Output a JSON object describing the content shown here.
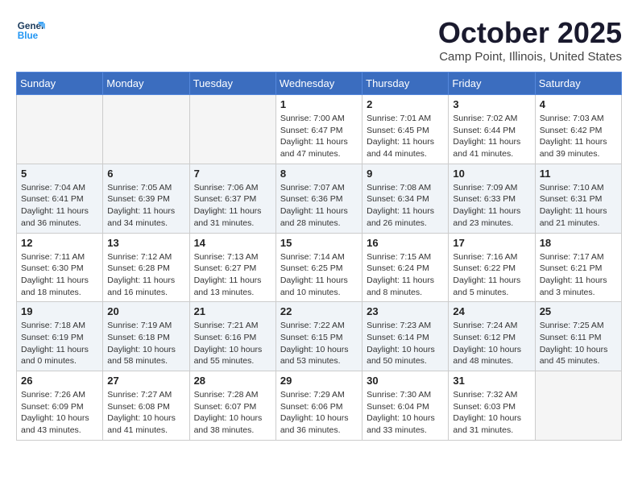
{
  "header": {
    "logo_line1": "General",
    "logo_line2": "Blue",
    "month": "October 2025",
    "location": "Camp Point, Illinois, United States"
  },
  "weekdays": [
    "Sunday",
    "Monday",
    "Tuesday",
    "Wednesday",
    "Thursday",
    "Friday",
    "Saturday"
  ],
  "weeks": [
    [
      {
        "day": "",
        "info": ""
      },
      {
        "day": "",
        "info": ""
      },
      {
        "day": "",
        "info": ""
      },
      {
        "day": "1",
        "info": "Sunrise: 7:00 AM\nSunset: 6:47 PM\nDaylight: 11 hours\nand 47 minutes."
      },
      {
        "day": "2",
        "info": "Sunrise: 7:01 AM\nSunset: 6:45 PM\nDaylight: 11 hours\nand 44 minutes."
      },
      {
        "day": "3",
        "info": "Sunrise: 7:02 AM\nSunset: 6:44 PM\nDaylight: 11 hours\nand 41 minutes."
      },
      {
        "day": "4",
        "info": "Sunrise: 7:03 AM\nSunset: 6:42 PM\nDaylight: 11 hours\nand 39 minutes."
      }
    ],
    [
      {
        "day": "5",
        "info": "Sunrise: 7:04 AM\nSunset: 6:41 PM\nDaylight: 11 hours\nand 36 minutes."
      },
      {
        "day": "6",
        "info": "Sunrise: 7:05 AM\nSunset: 6:39 PM\nDaylight: 11 hours\nand 34 minutes."
      },
      {
        "day": "7",
        "info": "Sunrise: 7:06 AM\nSunset: 6:37 PM\nDaylight: 11 hours\nand 31 minutes."
      },
      {
        "day": "8",
        "info": "Sunrise: 7:07 AM\nSunset: 6:36 PM\nDaylight: 11 hours\nand 28 minutes."
      },
      {
        "day": "9",
        "info": "Sunrise: 7:08 AM\nSunset: 6:34 PM\nDaylight: 11 hours\nand 26 minutes."
      },
      {
        "day": "10",
        "info": "Sunrise: 7:09 AM\nSunset: 6:33 PM\nDaylight: 11 hours\nand 23 minutes."
      },
      {
        "day": "11",
        "info": "Sunrise: 7:10 AM\nSunset: 6:31 PM\nDaylight: 11 hours\nand 21 minutes."
      }
    ],
    [
      {
        "day": "12",
        "info": "Sunrise: 7:11 AM\nSunset: 6:30 PM\nDaylight: 11 hours\nand 18 minutes."
      },
      {
        "day": "13",
        "info": "Sunrise: 7:12 AM\nSunset: 6:28 PM\nDaylight: 11 hours\nand 16 minutes."
      },
      {
        "day": "14",
        "info": "Sunrise: 7:13 AM\nSunset: 6:27 PM\nDaylight: 11 hours\nand 13 minutes."
      },
      {
        "day": "15",
        "info": "Sunrise: 7:14 AM\nSunset: 6:25 PM\nDaylight: 11 hours\nand 10 minutes."
      },
      {
        "day": "16",
        "info": "Sunrise: 7:15 AM\nSunset: 6:24 PM\nDaylight: 11 hours\nand 8 minutes."
      },
      {
        "day": "17",
        "info": "Sunrise: 7:16 AM\nSunset: 6:22 PM\nDaylight: 11 hours\nand 5 minutes."
      },
      {
        "day": "18",
        "info": "Sunrise: 7:17 AM\nSunset: 6:21 PM\nDaylight: 11 hours\nand 3 minutes."
      }
    ],
    [
      {
        "day": "19",
        "info": "Sunrise: 7:18 AM\nSunset: 6:19 PM\nDaylight: 11 hours\nand 0 minutes."
      },
      {
        "day": "20",
        "info": "Sunrise: 7:19 AM\nSunset: 6:18 PM\nDaylight: 10 hours\nand 58 minutes."
      },
      {
        "day": "21",
        "info": "Sunrise: 7:21 AM\nSunset: 6:16 PM\nDaylight: 10 hours\nand 55 minutes."
      },
      {
        "day": "22",
        "info": "Sunrise: 7:22 AM\nSunset: 6:15 PM\nDaylight: 10 hours\nand 53 minutes."
      },
      {
        "day": "23",
        "info": "Sunrise: 7:23 AM\nSunset: 6:14 PM\nDaylight: 10 hours\nand 50 minutes."
      },
      {
        "day": "24",
        "info": "Sunrise: 7:24 AM\nSunset: 6:12 PM\nDaylight: 10 hours\nand 48 minutes."
      },
      {
        "day": "25",
        "info": "Sunrise: 7:25 AM\nSunset: 6:11 PM\nDaylight: 10 hours\nand 45 minutes."
      }
    ],
    [
      {
        "day": "26",
        "info": "Sunrise: 7:26 AM\nSunset: 6:09 PM\nDaylight: 10 hours\nand 43 minutes."
      },
      {
        "day": "27",
        "info": "Sunrise: 7:27 AM\nSunset: 6:08 PM\nDaylight: 10 hours\nand 41 minutes."
      },
      {
        "day": "28",
        "info": "Sunrise: 7:28 AM\nSunset: 6:07 PM\nDaylight: 10 hours\nand 38 minutes."
      },
      {
        "day": "29",
        "info": "Sunrise: 7:29 AM\nSunset: 6:06 PM\nDaylight: 10 hours\nand 36 minutes."
      },
      {
        "day": "30",
        "info": "Sunrise: 7:30 AM\nSunset: 6:04 PM\nDaylight: 10 hours\nand 33 minutes."
      },
      {
        "day": "31",
        "info": "Sunrise: 7:32 AM\nSunset: 6:03 PM\nDaylight: 10 hours\nand 31 minutes."
      },
      {
        "day": "",
        "info": ""
      }
    ]
  ]
}
